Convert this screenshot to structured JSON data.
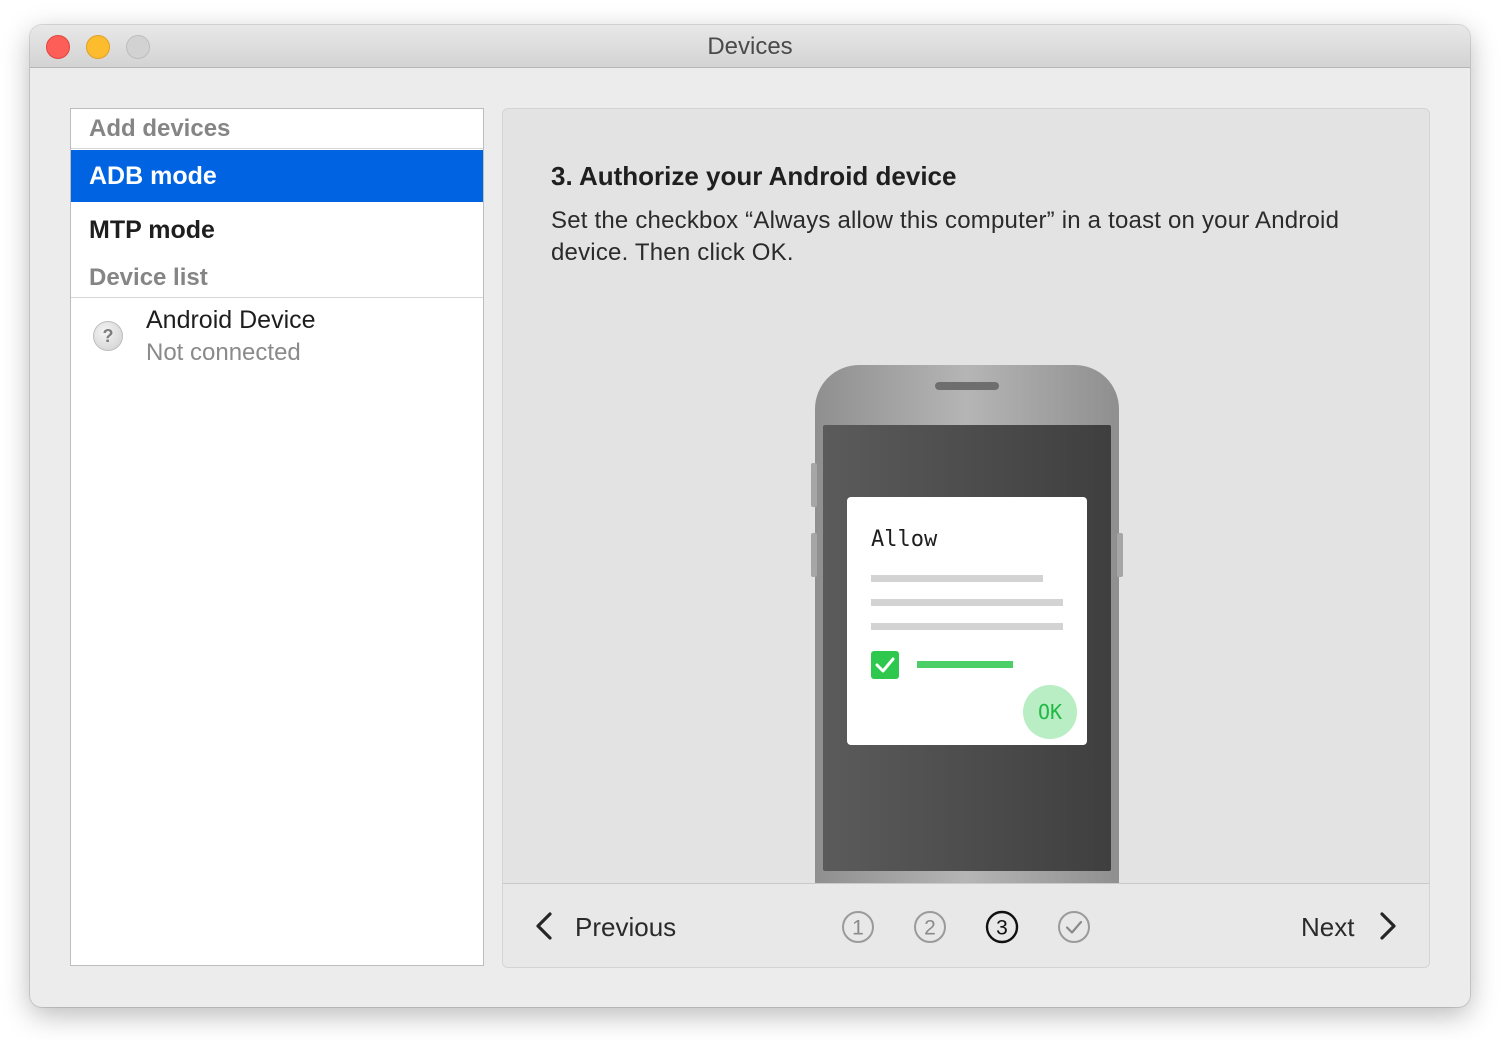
{
  "window": {
    "title": "Devices"
  },
  "sidebar": {
    "add_devices_header": "Add devices",
    "modes": [
      {
        "label": "ADB mode",
        "selected": true
      },
      {
        "label": "MTP mode",
        "selected": false
      }
    ],
    "device_list_header": "Device list",
    "devices": [
      {
        "name": "Android Device",
        "status": "Not connected",
        "icon": "question-mark-icon"
      }
    ]
  },
  "main": {
    "step_title": "3. Authorize your Android device",
    "step_description": "Set the checkbox “Always allow this computer” in a toast on your Android device. Then click OK.",
    "illustration": {
      "dialog_title": "Allow",
      "ok_label": "OK",
      "checkbox_checked": true
    }
  },
  "navigation": {
    "previous_label": "Previous",
    "next_label": "Next",
    "steps": [
      {
        "label": "1",
        "state": "done"
      },
      {
        "label": "2",
        "state": "done"
      },
      {
        "label": "3",
        "state": "current"
      },
      {
        "label": "✓",
        "state": "pending"
      }
    ]
  },
  "colors": {
    "selection": "#0063e1",
    "close": "#fd5e57",
    "minimize": "#fdbb2e",
    "zoom_inactive": "#d2d2d2",
    "check_green": "#2dc84d",
    "ok_bg": "#b9eec5",
    "ok_text": "#21b845"
  }
}
